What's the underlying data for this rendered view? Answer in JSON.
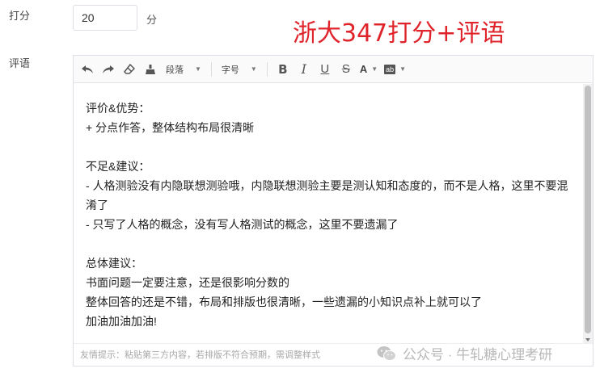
{
  "form": {
    "score_label": "打分",
    "score_value": "20",
    "score_unit": "分",
    "comment_label": "评语"
  },
  "overlay_title": "浙大347打分+评语",
  "toolbar": {
    "paragraph_label": "段落",
    "fontsize_label": "字号",
    "bold_label": "B",
    "italic_label": "I",
    "underline_label": "U",
    "strike_label": "S",
    "fontcolor_label": "A",
    "bgcolor_label": "ab"
  },
  "content": {
    "lines": [
      "评价&优势：",
      "+ 分点作答，整体结构布局很清晰",
      "",
      "不足&建议：",
      "- 人格测验没有内隐联想测验哦，内隐联想测验主要是测认知和态度的，而不是人格，这里不要混淆了",
      "- 只写了人格的概念，没有写人格测试的概念，这里不要遗漏了",
      "",
      "总体建议：",
      "书面问题一定要注意，还是很影响分数的",
      "整体回答的还是不错，布局和排版也很清晰，一些遗漏的小知识点补上就可以了",
      "加油加油加油!"
    ]
  },
  "hint": "友情提示：粘贴第三方内容，若排版不符合预期，需调整样式",
  "wechat_badge": "公众号 · 牛轧糖心理考研",
  "colors": {
    "overlay_title": "#e0242b",
    "border": "#dcdfe6"
  }
}
